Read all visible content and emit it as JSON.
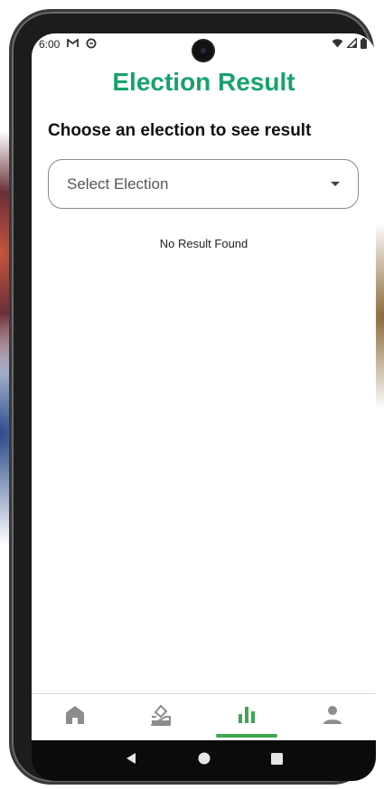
{
  "status_bar": {
    "time": "6:00"
  },
  "page": {
    "title": "Election Result",
    "prompt": "Choose an election to see result"
  },
  "election_select": {
    "placeholder": "Select Election"
  },
  "results": {
    "empty_message": "No Result Found"
  },
  "bottom_nav": {
    "items": [
      {
        "icon": "home-icon"
      },
      {
        "icon": "ballot-box-icon"
      },
      {
        "icon": "bar-chart-icon"
      },
      {
        "icon": "person-icon"
      }
    ],
    "active_index": 2
  },
  "colors": {
    "accent": "#17a26b",
    "active_tab": "#3aa84f",
    "inactive_icon": "#8c8c8c"
  }
}
